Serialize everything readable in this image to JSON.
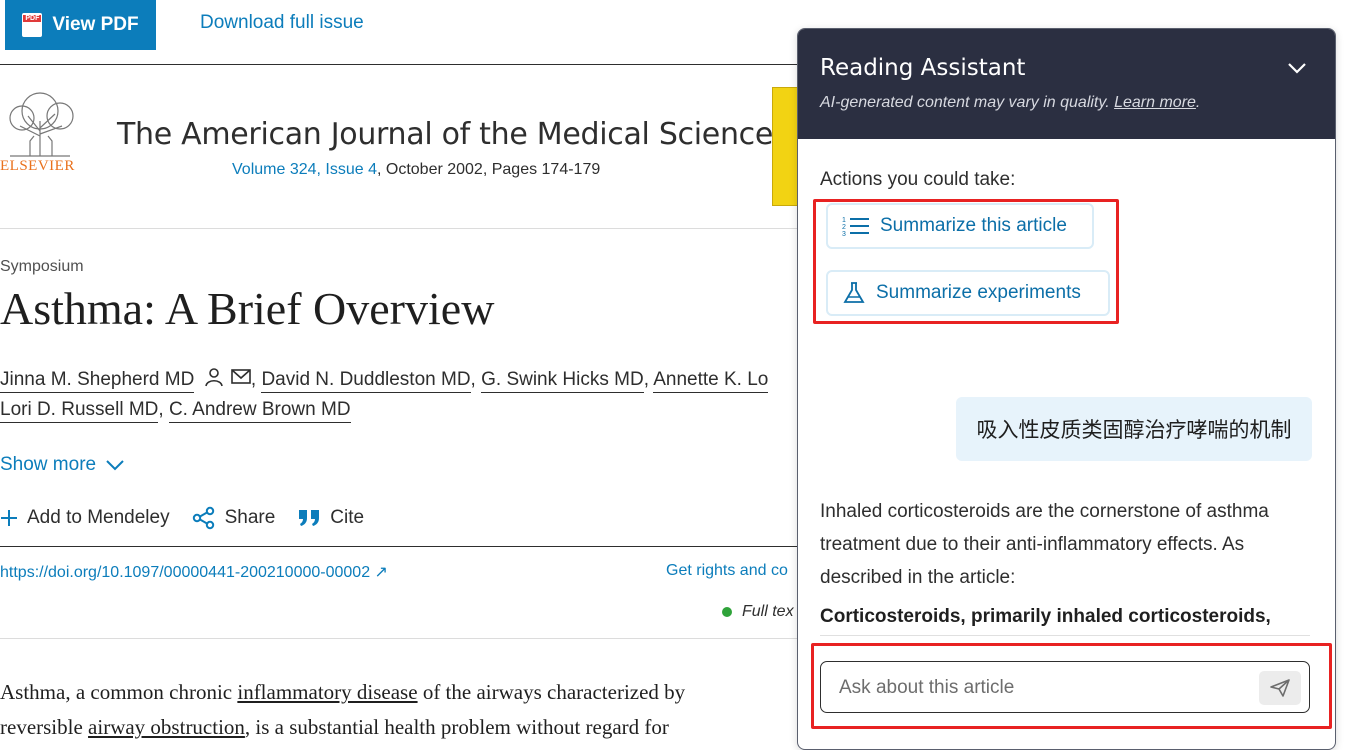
{
  "topbar": {
    "view_pdf": "View PDF",
    "download_issue": "Download full issue"
  },
  "journal": {
    "publisher": "ELSEVIER",
    "title": "The American Journal of the Medical Sciences",
    "volume_issue": "Volume 324, Issue 4",
    "date_pages": ", October 2002, Pages 174-179"
  },
  "article": {
    "section": "Symposium",
    "title": "Asthma: A Brief Overview",
    "authors_line1": [
      "Jinna M. Shepherd MD",
      "David N. Duddleston MD",
      "G. Swink Hicks MD",
      "Annette K. Lo"
    ],
    "authors_line2": [
      "Lori D. Russell MD",
      "C. Andrew Brown MD"
    ],
    "show_more": "Show more",
    "actions": {
      "mendeley": "Add to Mendeley",
      "share": "Share",
      "cite": "Cite"
    },
    "doi": "https://doi.org/10.1097/00000441-200210000-00002",
    "rights": "Get rights and co",
    "fulltext": "Full tex",
    "abstract": {
      "l1a": "Asthma, a common chronic ",
      "l1b": "inflammatory disease",
      "l1c": " of the airways characterized by",
      "l2a": "reversible ",
      "l2b": "airway obstruction",
      "l2c": ", is a substantial health problem without regard for"
    }
  },
  "assistant": {
    "title": "Reading Assistant",
    "subtitle": "AI-generated content may vary in quality.",
    "learn_more": "Learn more",
    "actions_label": "Actions you could take:",
    "action_summarize_article": "Summarize this article",
    "action_summarize_experiments": "Summarize experiments",
    "user_message": "吸入性皮质类固醇治疗哮喘的机制",
    "answer": "Inhaled corticosteroids are the cornerstone of asthma treatment due to their anti-inflammatory effects. As described in the article:",
    "answer_bold": "Corticosteroids, primarily inhaled corticosteroids,",
    "input_placeholder": "Ask about this article"
  },
  "colors": {
    "accent": "#0c7dbb",
    "panel_header": "#2b2f41",
    "highlight_red": "#e82222",
    "elsevier_orange": "#e9711c"
  }
}
